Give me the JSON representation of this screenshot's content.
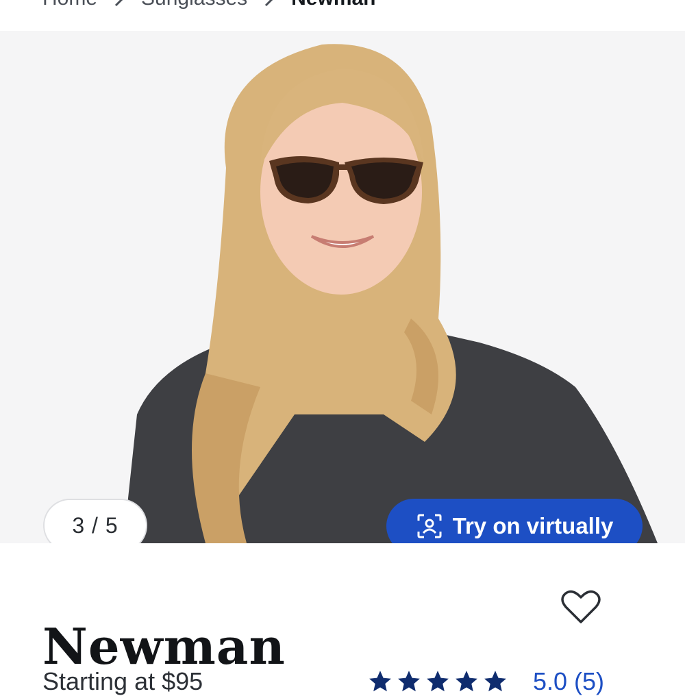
{
  "breadcrumb": {
    "items": [
      "Home",
      "Sunglasses"
    ],
    "current": "Newman"
  },
  "gallery": {
    "counter": "3 / 5",
    "current_index": 3,
    "total": 5,
    "try_on_label": "Try on virtually"
  },
  "product": {
    "name": "Newman",
    "price_text": "Starting at $95",
    "rating_text": "5.0 (5)",
    "rating_value": 5.0,
    "review_count": 5
  },
  "icons": {
    "breadcrumb_separator": "chevron-right-icon",
    "try_on": "face-scan-icon",
    "favorite": "heart-icon",
    "rating": "star-icon"
  },
  "colors": {
    "accent": "#1d4fc4",
    "star": "#0f2c6e",
    "hero_bg": "#f5f5f6"
  }
}
